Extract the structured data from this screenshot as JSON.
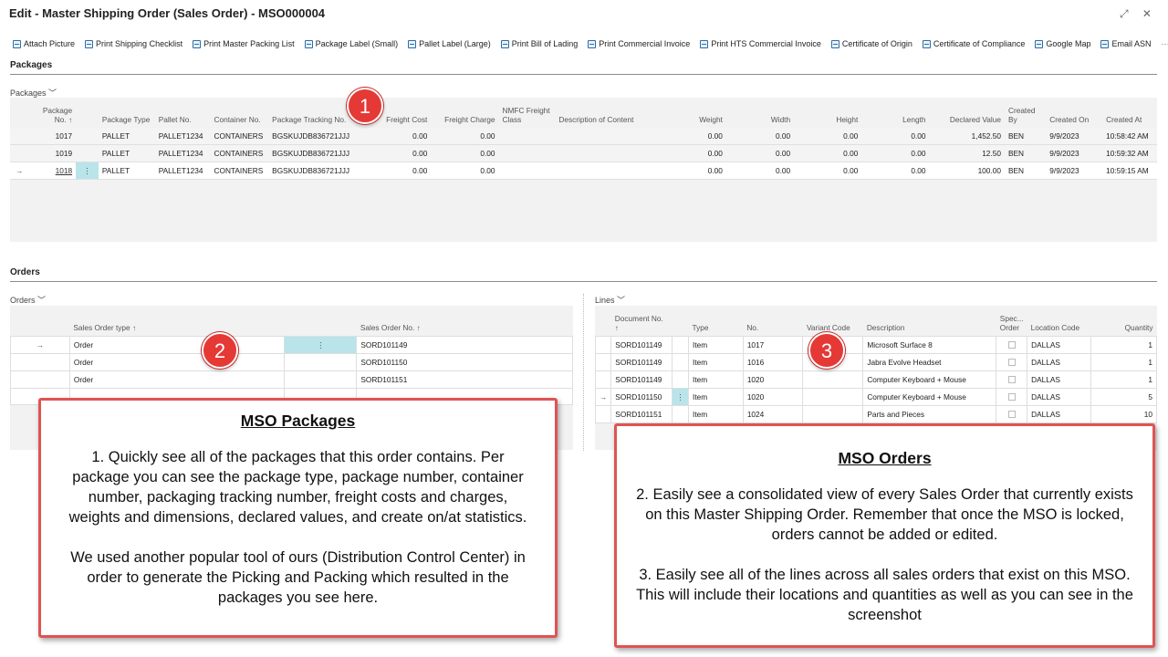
{
  "window": {
    "title": "Edit - Master Shipping Order (Sales Order) - MSO000004",
    "controls": "⤢ ✕"
  },
  "actions": [
    "Attach Picture",
    "Print Shipping Checklist",
    "Print Master Packing List",
    "Package Label (Small)",
    "Pallet Label (Large)",
    "Print Bill of Lading",
    "Print Commercial Invoice",
    "Print HTS Commercial Invoice",
    "Certificate of Origin",
    "Certificate of Compliance",
    "Google Map",
    "Email ASN",
    "···"
  ],
  "packages": {
    "section_title": "Packages",
    "sublabel": "Packages",
    "headers": [
      "Package No. ↑",
      "Package Type",
      "Pallet No.",
      "Container No.",
      "Package Tracking No.",
      "Freight Cost",
      "Freight Charge",
      "NMFC Freight Class",
      "Description of Content",
      "Weight",
      "Width",
      "Height",
      "Length",
      "Declared Value",
      "Created By",
      "Created On",
      "Created At"
    ],
    "rows": [
      [
        "1017",
        "PALLET",
        "PALLET1234",
        "CONTAINERS",
        "BGSKUJDB836721JJJ",
        "0.00",
        "0.00",
        "",
        "",
        "0.00",
        "0.00",
        "0.00",
        "0.00",
        "1,452.50",
        "BEN",
        "9/9/2023",
        "10:58:42 AM"
      ],
      [
        "1019",
        "PALLET",
        "PALLET1234",
        "CONTAINERS",
        "BGSKUJDB836721JJJ",
        "0.00",
        "0.00",
        "",
        "",
        "0.00",
        "0.00",
        "0.00",
        "0.00",
        "12.50",
        "BEN",
        "9/9/2023",
        "10:59:32 AM"
      ],
      [
        "1018",
        "PALLET",
        "PALLET1234",
        "CONTAINERS",
        "BGSKUJDB836721JJJ",
        "0.00",
        "0.00",
        "",
        "",
        "0.00",
        "0.00",
        "0.00",
        "0.00",
        "100.00",
        "BEN",
        "9/9/2023",
        "10:59:15 AM"
      ]
    ]
  },
  "orders": {
    "section_title": "Orders",
    "sublabel": "Orders",
    "headers": [
      "Sales Order type ↑",
      "Sales Order No. ↑"
    ],
    "rows": [
      [
        "Order",
        "SORD101149"
      ],
      [
        "Order",
        "SORD101150"
      ],
      [
        "Order",
        "SORD101151"
      ]
    ]
  },
  "lines": {
    "sublabel": "Lines",
    "headers": [
      "Document No. ↑",
      "Type",
      "No.",
      "Variant Code",
      "Description",
      "Spec... Order",
      "Location Code",
      "Quantity"
    ],
    "rows": [
      [
        "SORD101149",
        "Item",
        "1017",
        "",
        "Microsoft Surface 8",
        "",
        "DALLAS",
        "1"
      ],
      [
        "SORD101149",
        "Item",
        "1016",
        "",
        "Jabra Evolve Headset",
        "",
        "DALLAS",
        "1"
      ],
      [
        "SORD101149",
        "Item",
        "1020",
        "",
        "Computer Keyboard + Mouse",
        "",
        "DALLAS",
        "1"
      ],
      [
        "SORD101150",
        "Item",
        "1020",
        "",
        "Computer Keyboard + Mouse",
        "",
        "DALLAS",
        "5"
      ],
      [
        "SORD101151",
        "Item",
        "1024",
        "",
        "Parts and Pieces",
        "",
        "DALLAS",
        "10"
      ]
    ]
  },
  "markers": {
    "arrow": "→",
    "dots": "⋮"
  },
  "badges": [
    "1",
    "2",
    "3"
  ],
  "callout_packages": {
    "title": "MSO Packages",
    "p1": "1. Quickly see all of the packages that this order contains. Per package you can see the package type, package number, container number, packaging tracking number, freight costs and charges, weights and dimensions, declared values, and create on/at statistics.",
    "p2": "We used another popular tool of ours (Distribution Control Center) in order to generate the Picking and Packing which resulted in the packages you see here."
  },
  "callout_orders": {
    "title": "MSO Orders",
    "p1": "2. Easily see a consolidated view of every Sales Order that currently exists on this Master Shipping Order. Remember that once the MSO is locked, orders cannot be added or edited.",
    "p2": "3. Easily see all of the lines across all sales orders that exist on this MSO. This will include their locations and quantities as well as you can see in the screenshot"
  }
}
